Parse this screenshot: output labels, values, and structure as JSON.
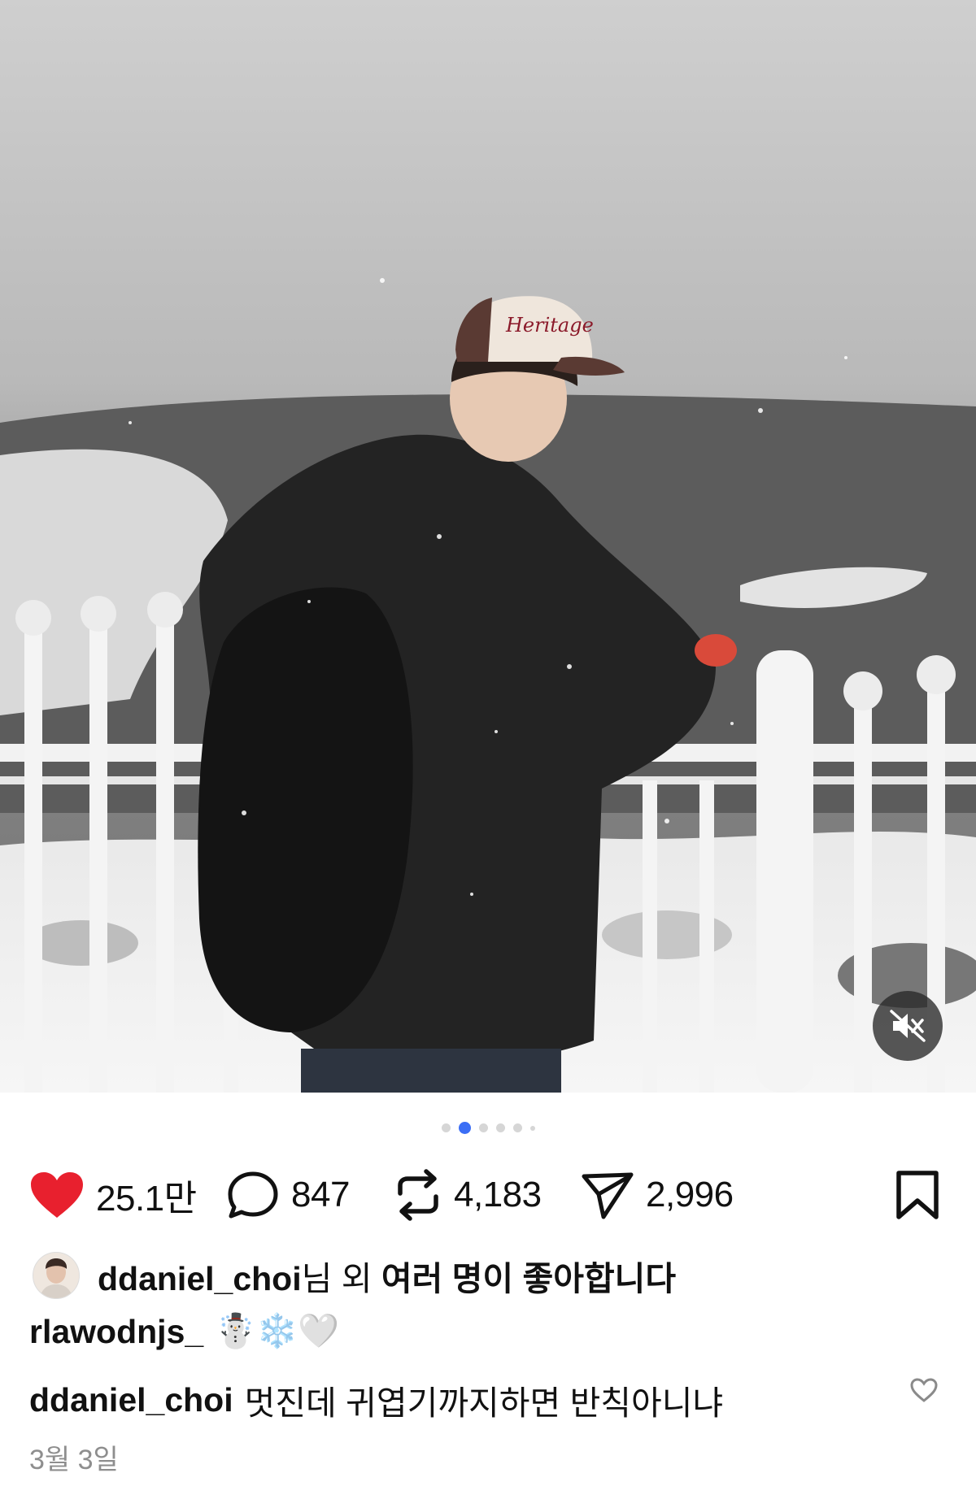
{
  "post": {
    "pagination": {
      "total": 6,
      "active_index": 1
    },
    "actions": {
      "like_count": "25.1만",
      "comment_count": "847",
      "repost_count": "4,183",
      "share_count": "2,996"
    },
    "liked_by": {
      "user": "ddaniel_choi",
      "suffix_plain": "님 외 ",
      "suffix_bold": "여러 명이 좋아합니다"
    },
    "comments": [
      {
        "user": "rlawodnjs_",
        "text": "☃️❄️🤍"
      },
      {
        "user": "ddaniel_choi",
        "text": "멋진데 귀엽기까지하면 반칙아니냐"
      }
    ],
    "date": "3월 3일"
  },
  "colors": {
    "like": "#e8202e",
    "pagination_active": "#3b6ef5",
    "muted_text": "#8e8e8e"
  },
  "icons": [
    "heart-icon",
    "comment-icon",
    "repost-icon",
    "share-icon",
    "bookmark-icon",
    "mute-icon",
    "small-heart-icon"
  ]
}
